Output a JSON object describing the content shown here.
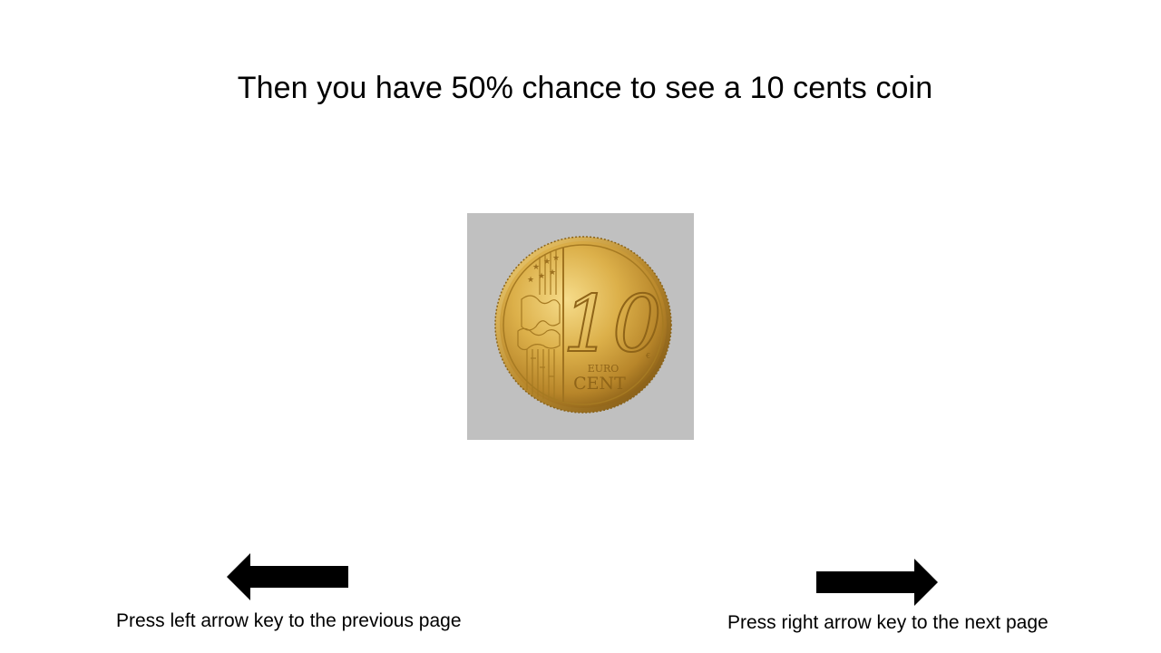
{
  "title": "Then you have 50% chance to see a 10 cents coin",
  "coin": {
    "icon": "ten-euro-cent-coin",
    "value_text": "10",
    "euro_text": "EURO",
    "cent_text": "CENT",
    "background_color": "#c0c0c0",
    "gold_color": "#d9aa3c"
  },
  "navigation": {
    "left": {
      "icon": "left-arrow-icon",
      "label": "Press left arrow key to the previous page"
    },
    "right": {
      "icon": "right-arrow-icon",
      "label": "Press right arrow key to the next page"
    }
  }
}
